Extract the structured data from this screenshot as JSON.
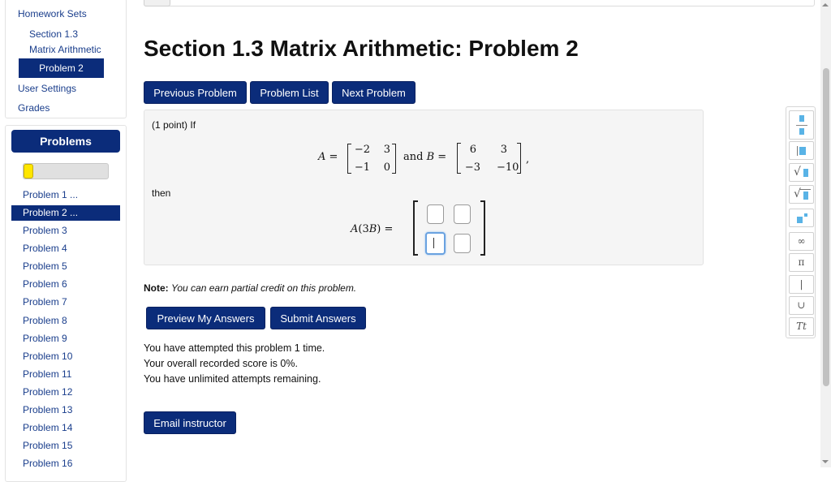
{
  "nav": {
    "homework_sets": "Homework Sets",
    "section_line1": "Section 1.3",
    "section_line2": "Matrix Arithmetic",
    "current_problem": "Problem 2",
    "user_settings": "User Settings",
    "grades": "Grades"
  },
  "sidebar": {
    "heading": "Problems",
    "progress_fraction": 0.0,
    "problems": [
      "Problem 1 ...",
      "Problem 2 ...",
      "Problem 3",
      "Problem 4",
      "Problem 5",
      "Problem 6",
      "Problem 7",
      "Problem 8",
      "Problem 9",
      "Problem 10",
      "Problem 11",
      "Problem 12",
      "Problem 13",
      "Problem 14",
      "Problem 15",
      "Problem 16"
    ],
    "current_index": 1
  },
  "page": {
    "title": "Section 1.3 Matrix Arithmetic: Problem 2"
  },
  "nav_buttons": {
    "previous": "Previous Problem",
    "list": "Problem List",
    "next": "Next Problem"
  },
  "problem": {
    "intro": "(1 point) If",
    "then": "then",
    "matrix_a_name": "A",
    "matrix_a": [
      [
        "−2",
        "3"
      ],
      [
        "−1",
        "0"
      ]
    ],
    "and_text": "and",
    "matrix_b_name": "B",
    "matrix_b": [
      [
        "6",
        "3"
      ],
      [
        "−3",
        "−10"
      ]
    ],
    "expression": "A(3B)",
    "equals": "=",
    "answers": [
      "",
      "",
      "",
      ""
    ]
  },
  "note": {
    "label": "Note:",
    "text": "You can earn partial credit on this problem."
  },
  "actions": {
    "preview": "Preview My Answers",
    "submit": "Submit Answers",
    "email": "Email instructor"
  },
  "status": {
    "attempts": "You have attempted this problem 1 time.",
    "score": "Your overall recorded score is 0%.",
    "remaining": "You have unlimited attempts remaining."
  },
  "toolbar": {
    "buttons": [
      "fraction-icon",
      "exponent-icon",
      "sqrt-icon",
      "nth-root-icon",
      "subscript-icon",
      "infinity-icon",
      "pi-icon",
      "vertical-bar-icon",
      "union-icon",
      "text-mode-icon"
    ],
    "infinity": "∞",
    "pi": "π",
    "bar": "|",
    "union": "∪",
    "text": "Tt"
  },
  "colors": {
    "primary": "#0b2c7a",
    "progress": "#ffe600",
    "toolbar_accent": "#59b3e6",
    "input_focus": "#6aa2e0"
  }
}
